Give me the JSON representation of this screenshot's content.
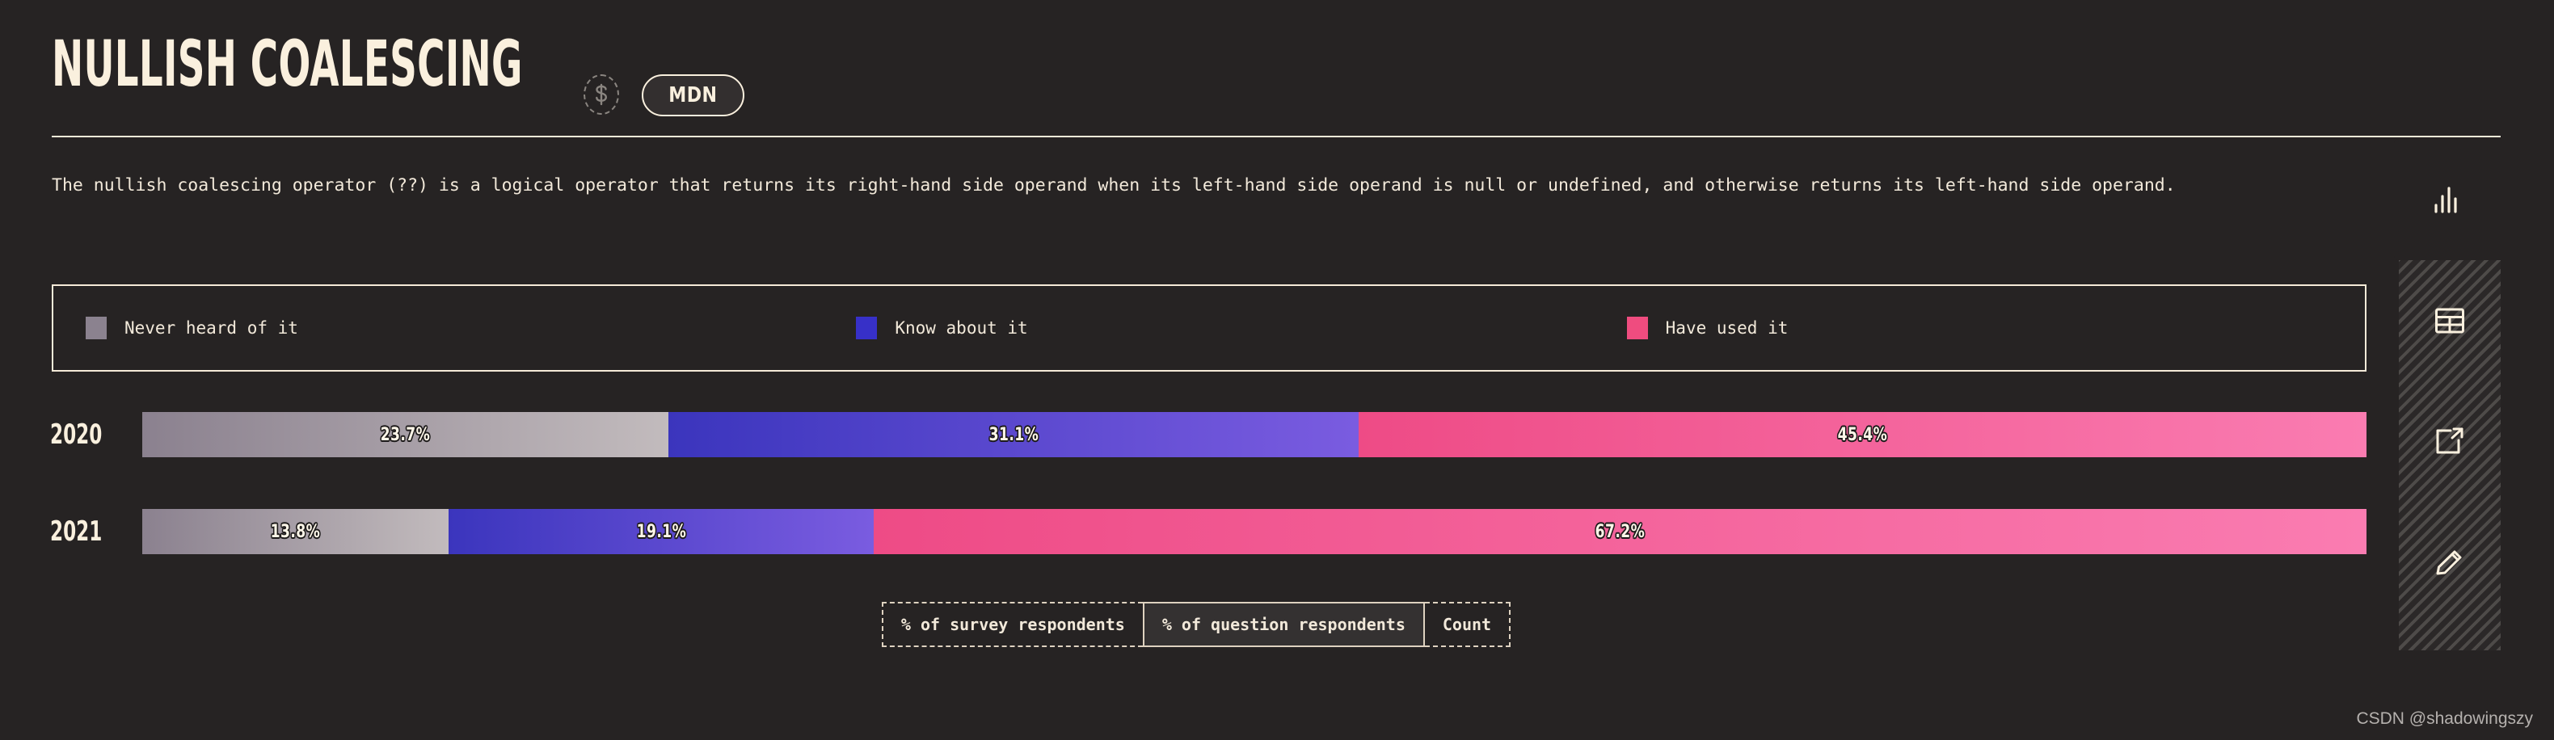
{
  "header": {
    "title": "NULLISH COALESCING",
    "dollar_icon": "dollar-circle-icon",
    "badge_label": "MDN"
  },
  "description": "The nullish coalescing operator (??) is a logical operator that returns its right-hand side operand when its left-hand side operand is null or undefined, and otherwise returns its left-hand side operand.",
  "legend": {
    "items": [
      {
        "label": "Never heard of it",
        "color": "#8b828f"
      },
      {
        "label": "Know about it",
        "color": "#3730c8"
      },
      {
        "label": "Have used it",
        "color": "#ef4c7f"
      }
    ]
  },
  "unit_toggle": {
    "options": [
      {
        "label": "% of survey respondents",
        "selected": false
      },
      {
        "label": "% of question respondents",
        "selected": true
      },
      {
        "label": "Count",
        "selected": false
      }
    ]
  },
  "sidebar": {
    "items": [
      {
        "name": "chart-view",
        "icon": "bar-chart-icon",
        "active": true
      },
      {
        "name": "table-view",
        "icon": "table-icon",
        "active": false
      },
      {
        "name": "share-view",
        "icon": "external-link-icon",
        "active": false
      },
      {
        "name": "edit-view",
        "icon": "pencil-icon",
        "active": false
      }
    ]
  },
  "watermark": "CSDN @shadowingszy",
  "colors": {
    "background": "#262323",
    "foreground": "#faf0de",
    "never_heard_from": "#8b818f",
    "never_heard_to": "#c2bbbd",
    "know_about_from": "#3b35bd",
    "know_about_to": "#7a5ce0",
    "have_used_from": "#ee4b86",
    "have_used_to": "#fa7cb1"
  },
  "chart_data": {
    "type": "bar",
    "orientation": "horizontal",
    "stacked": true,
    "normalized": true,
    "title": "NULLISH COALESCING",
    "xlabel": "",
    "ylabel": "",
    "unit": "% of question respondents",
    "xlim": [
      0,
      100
    ],
    "grid": false,
    "legend_position": "top",
    "categories": [
      "2020",
      "2021"
    ],
    "series": [
      {
        "name": "Never heard of it",
        "color": "#8b818f",
        "values": [
          23.7,
          13.8
        ],
        "labels": [
          "23.7%",
          "13.8%"
        ]
      },
      {
        "name": "Know about it",
        "color": "#3b35bd",
        "values": [
          31.1,
          19.1
        ],
        "labels": [
          "31.1%",
          "19.1%"
        ]
      },
      {
        "name": "Have used it",
        "color": "#ee4b86",
        "values": [
          45.4,
          67.2
        ],
        "labels": [
          "45.4%",
          "67.2%"
        ]
      }
    ],
    "rows": [
      {
        "year": "2020",
        "segments": [
          {
            "label": "23.7%",
            "value": 23.7
          },
          {
            "label": "31.1%",
            "value": 31.1
          },
          {
            "label": "45.4%",
            "value": 45.4
          }
        ]
      },
      {
        "year": "2021",
        "segments": [
          {
            "label": "13.8%",
            "value": 13.8
          },
          {
            "label": "19.1%",
            "value": 19.1
          },
          {
            "label": "67.2%",
            "value": 67.2
          }
        ]
      }
    ]
  }
}
